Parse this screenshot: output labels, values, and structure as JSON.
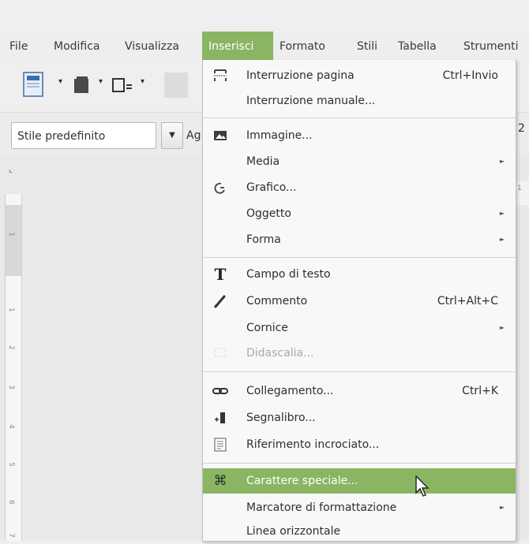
{
  "menubar": {
    "items": [
      "File",
      "Modifica",
      "Visualizza",
      "Inserisci",
      "Formato",
      "Stili",
      "Tabella",
      "Strumenti"
    ],
    "active_index": 3
  },
  "toolbar": {
    "style_value": "Stile predefinito",
    "font_partial": "Ag",
    "right_partial": "2"
  },
  "ruler": {
    "marks": [
      "1",
      "1",
      "2",
      "3",
      "4",
      "5",
      "6",
      "7"
    ],
    "right_mark": "1"
  },
  "menu": {
    "items": [
      {
        "label": "Interruzione pagina",
        "shortcut": "Ctrl+Invio",
        "icon": "page-break-icon"
      },
      {
        "label": "Interruzione manuale...",
        "shortcut": ""
      },
      {
        "label": "Immagine...",
        "icon": "image-icon"
      },
      {
        "label": "Media",
        "submenu": true
      },
      {
        "label": "Grafico...",
        "icon": "chart-icon"
      },
      {
        "label": "Oggetto",
        "submenu": true
      },
      {
        "label": "Forma",
        "submenu": true
      },
      {
        "label": "Campo di testo",
        "icon": "text-field-icon"
      },
      {
        "label": "Commento",
        "shortcut": "Ctrl+Alt+C",
        "icon": "comment-pen-icon"
      },
      {
        "label": "Cornice",
        "submenu": true
      },
      {
        "label": "Didascalia...",
        "disabled": true,
        "icon": "caption-icon"
      },
      {
        "label": "Collegamento...",
        "shortcut": "Ctrl+K",
        "icon": "hyperlink-icon"
      },
      {
        "label": "Segnalibro...",
        "icon": "bookmark-icon"
      },
      {
        "label": "Riferimento incrociato...",
        "icon": "cross-reference-icon"
      },
      {
        "label": "Carattere speciale...",
        "highlighted": true,
        "icon": "special-character-icon"
      },
      {
        "label": "Marcatore di formattazione",
        "submenu": true
      },
      {
        "label": "Linea orizzontale"
      }
    ]
  },
  "colors": {
    "accent": "#8ab563",
    "menu_bg": "#f8f8f8"
  }
}
